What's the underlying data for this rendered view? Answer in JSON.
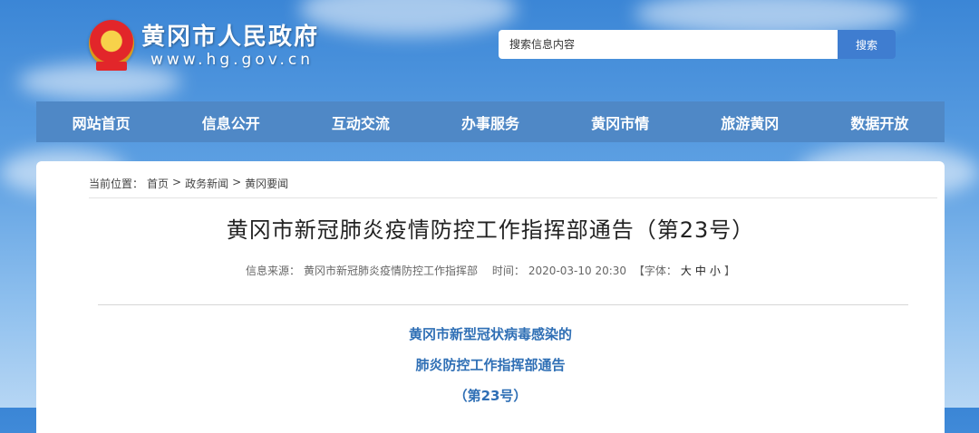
{
  "header": {
    "site_name": "黄冈市人民政府",
    "site_url": "www.hg.gov.cn",
    "search_placeholder": "搜索信息内容",
    "search_button": "搜索"
  },
  "nav": {
    "items": [
      "网站首页",
      "信息公开",
      "互动交流",
      "办事服务",
      "黄冈市情",
      "旅游黄冈",
      "数据开放"
    ]
  },
  "breadcrumb": {
    "prefix": "当前位置：",
    "items": [
      "首页",
      "政务新闻",
      "黄冈要闻"
    ],
    "sep": ">"
  },
  "article": {
    "title": "黄冈市新冠肺炎疫情防控工作指挥部通告（第23号）",
    "source_label": "信息来源：",
    "source": "黄冈市新冠肺炎疫情防控工作指挥部",
    "time_label": "时间：",
    "time": "2020-03-10 20:30",
    "font_label": "【字体：",
    "font_large": "大",
    "font_medium": "中",
    "font_small": "小",
    "font_close": "】",
    "headings": [
      "黄冈市新型冠状病毒感染的",
      "肺炎防控工作指挥部通告",
      "（第23号）"
    ]
  },
  "colors": {
    "sky": "#4a90dc",
    "nav": "#4f88c6",
    "search_button": "#3f7dd0",
    "heading_blue": "#2f6fb5"
  }
}
